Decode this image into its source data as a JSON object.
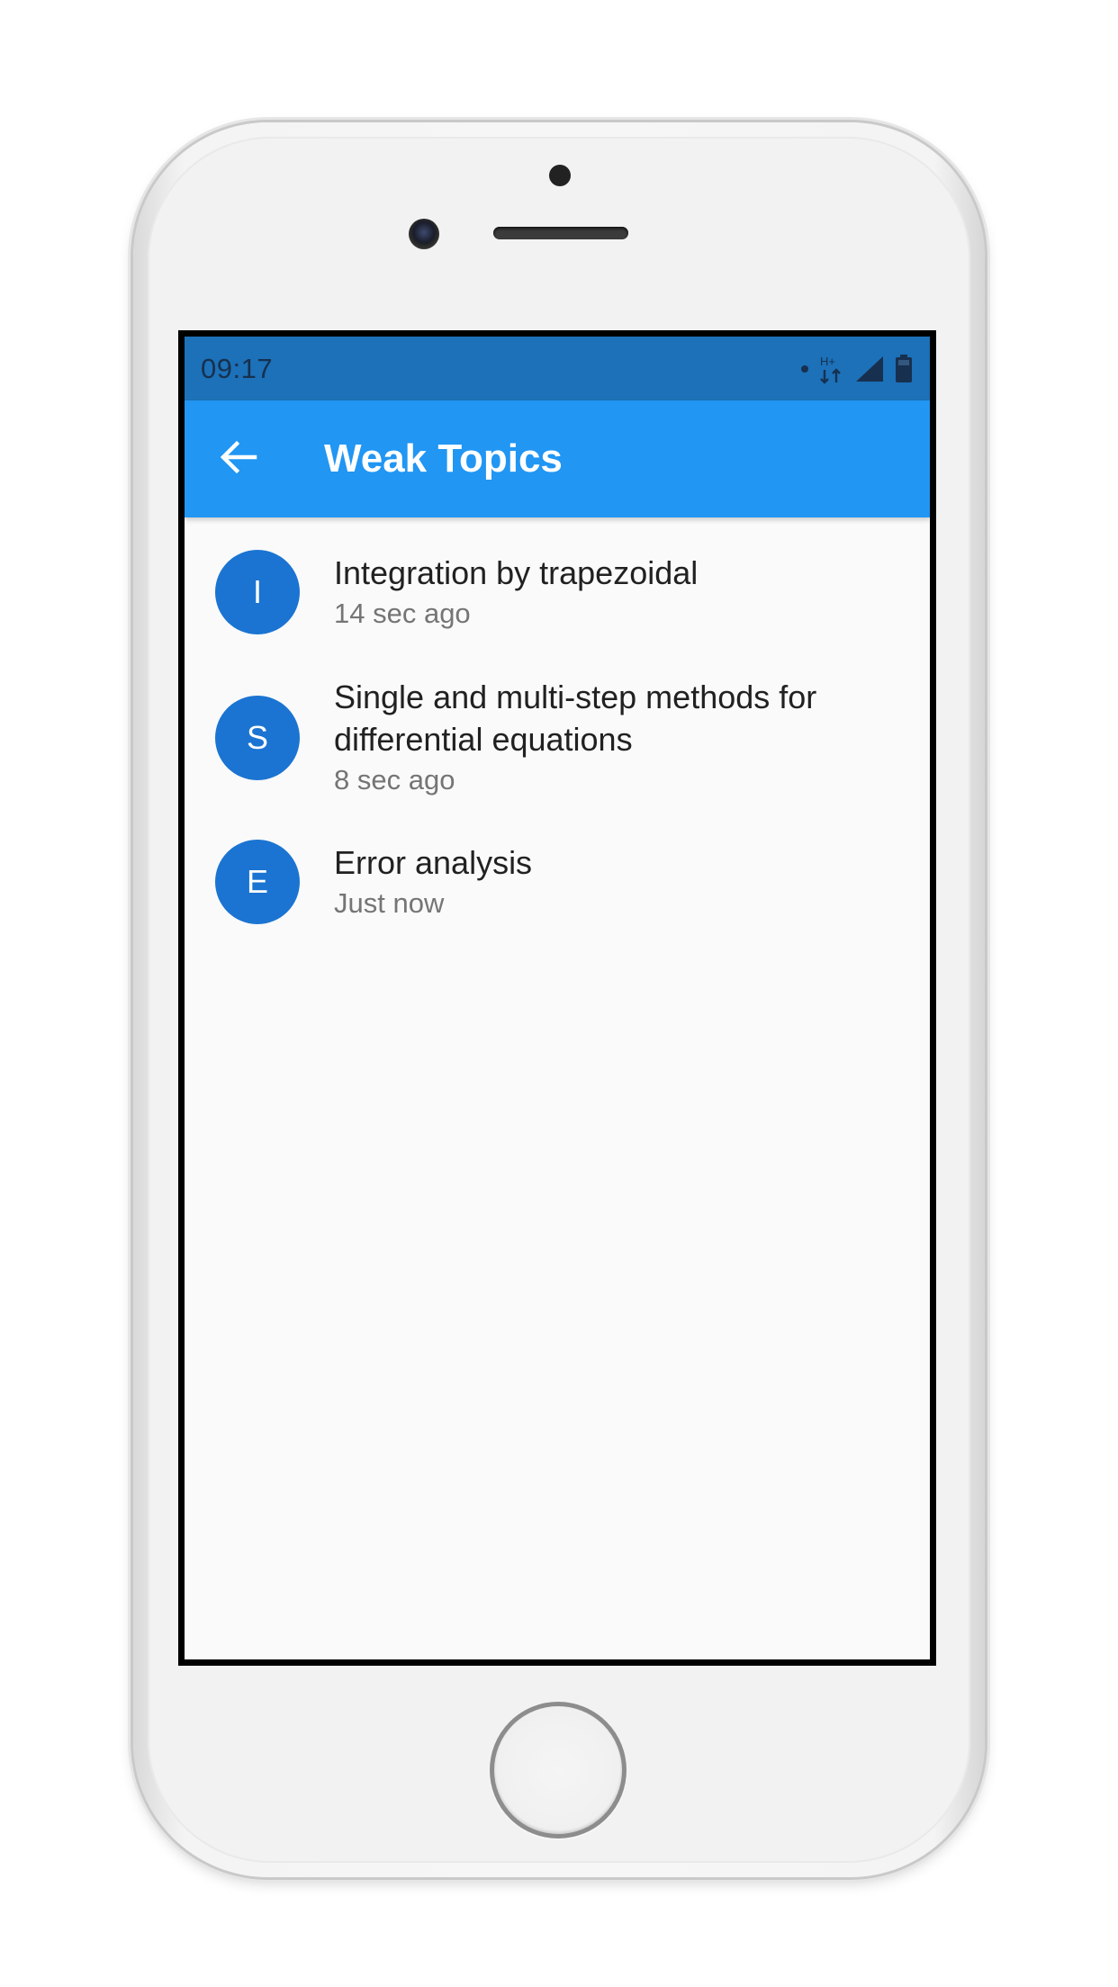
{
  "status_bar": {
    "time": "09:17",
    "network_label": "H+"
  },
  "app_bar": {
    "title": "Weak Topics",
    "back_icon": "arrow-left-icon"
  },
  "topics": [
    {
      "avatar_letter": "I",
      "title": "Integration by trapezoidal",
      "subtitle": "14 sec ago"
    },
    {
      "avatar_letter": "S",
      "title": "Single and multi-step methods for differential equations",
      "subtitle": "8 sec ago"
    },
    {
      "avatar_letter": "E",
      "title": "Error analysis",
      "subtitle": "Just now"
    }
  ],
  "colors": {
    "status_bar": "#1c71b8",
    "app_bar": "#2196f3",
    "avatar": "#1b74d2",
    "background": "#fafafa"
  }
}
